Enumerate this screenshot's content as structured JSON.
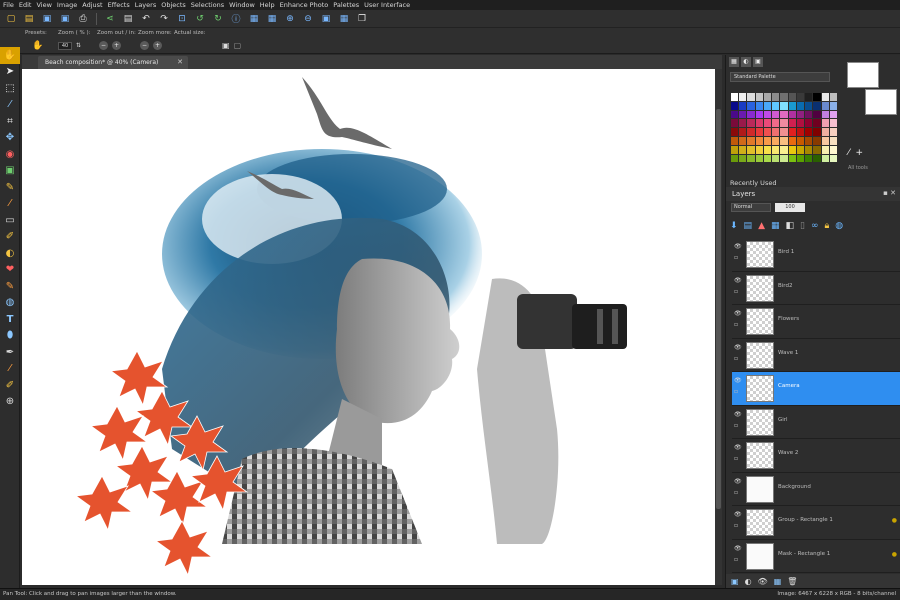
{
  "menu": [
    "File",
    "Edit",
    "View",
    "Image",
    "Adjust",
    "Effects",
    "Layers",
    "Objects",
    "Selections",
    "Window",
    "Help",
    "Enhance Photo",
    "Palettes",
    "User Interface"
  ],
  "toolbar_icons": [
    "new-file-icon",
    "open-icon",
    "save-icon",
    "save-as-icon",
    "print-icon",
    "share-icon",
    "undo-icon",
    "redo-icon",
    "crop-icon",
    "rotate-left-icon",
    "rotate-right-icon",
    "zoom-in-icon",
    "zoom-out-icon",
    "fit-icon",
    "grid-icon",
    "window-icon"
  ],
  "options": {
    "presets_label": "Presets:",
    "zoom_pct_label": "Zoom ( % ):",
    "zoom_pct_value": "40",
    "zoom_inout_label": "Zoom out / in:",
    "zoom_more_label": "Zoom more:",
    "actual_size_label": "Actual size:"
  },
  "tools": [
    "pan-icon",
    "pick-icon",
    "selection-icon",
    "dropper-icon",
    "crop-icon",
    "move-icon",
    "redeye-icon",
    "makeover-icon",
    "clone-icon",
    "scratch-icon",
    "eraser-icon",
    "smudge-icon",
    "dodge-icon",
    "retouch-icon",
    "paint-icon",
    "fill-icon",
    "text-icon",
    "shape-icon",
    "pen-icon",
    "brush-icon",
    "airbrush-icon",
    "add-icon"
  ],
  "document": {
    "tab_title": "Beach composition* @  40% (Camera)",
    "close_symbol": "✕"
  },
  "materials": {
    "palette_name": "Standard Palette",
    "all_tools": "All tools",
    "swatch_colors": [
      "#ffffff",
      "#f0f0f0",
      "#dcdcdc",
      "#c4c4c4",
      "#a8a8a8",
      "#8c8c8c",
      "#707070",
      "#555555",
      "#3a3a3a",
      "#202020",
      "#000000",
      "#e8e8e8",
      "#bdbdbd",
      "#0a0a8a",
      "#1a3cc4",
      "#2a62e0",
      "#3a86f0",
      "#4aa8f8",
      "#60c8ff",
      "#80e0ff",
      "#1a9ad0",
      "#0a6cb0",
      "#0a4e90",
      "#0a3070",
      "#6a8ad0",
      "#8ab0e8",
      "#4a0a8a",
      "#6a1ab0",
      "#8a2ad0",
      "#aa3af0",
      "#c04ae8",
      "#d05ad0",
      "#e06ac0",
      "#b030a0",
      "#902080",
      "#701060",
      "#500040",
      "#c080e0",
      "#e0a0f0",
      "#7a0a3a",
      "#9a1a4a",
      "#ba2a5a",
      "#da3a6a",
      "#ea4a7a",
      "#f06a8a",
      "#f08aa0",
      "#d02050",
      "#b01040",
      "#900030",
      "#700020",
      "#f0a0b0",
      "#f8c0d0",
      "#8a0a0a",
      "#b01a1a",
      "#d02a2a",
      "#e83a3a",
      "#f05050",
      "#f07070",
      "#f09090",
      "#e02020",
      "#c01010",
      "#a00000",
      "#800000",
      "#f0b0a0",
      "#f8d0c0",
      "#c05a0a",
      "#d06a1a",
      "#e07a2a",
      "#f08a3a",
      "#f89a4a",
      "#f8aa60",
      "#f8c080",
      "#e86a10",
      "#c85a00",
      "#a84a00",
      "#883a00",
      "#f8c8a0",
      "#f8e0c0",
      "#c0a00a",
      "#d0b01a",
      "#e0c02a",
      "#f0d03a",
      "#f8e04a",
      "#f8e870",
      "#f8f090",
      "#e8c810",
      "#c8a800",
      "#a88800",
      "#886800",
      "#f8f0b0",
      "#fff8d0",
      "#6a9a0a",
      "#7aaa1a",
      "#8aba2a",
      "#9aca3a",
      "#aada4a",
      "#bae070",
      "#ccea90",
      "#7ac010",
      "#5aa000",
      "#3a8000",
      "#2a6000",
      "#d0f0a0",
      "#e8f8c0"
    ]
  },
  "recently_used": "Recently Used",
  "layers_panel": {
    "title": "Layers",
    "blend_mode": "Normal",
    "opacity": "100",
    "layers": [
      {
        "name": "Bird 1",
        "selected": false,
        "solid": false,
        "star": false
      },
      {
        "name": "Bird2",
        "selected": false,
        "solid": false,
        "star": false
      },
      {
        "name": "Flowers",
        "selected": false,
        "solid": false,
        "star": false
      },
      {
        "name": "Wave 1",
        "selected": false,
        "solid": false,
        "star": false
      },
      {
        "name": "Camera",
        "selected": true,
        "solid": false,
        "star": false
      },
      {
        "name": "Girl",
        "selected": false,
        "solid": false,
        "star": false
      },
      {
        "name": "Wave 2",
        "selected": false,
        "solid": false,
        "star": false
      },
      {
        "name": "Background",
        "selected": false,
        "solid": true,
        "star": false
      },
      {
        "name": "Group - Rectangle 1",
        "selected": false,
        "solid": false,
        "star": true
      },
      {
        "name": "Mask - Rectangle 1",
        "selected": false,
        "solid": true,
        "star": true
      }
    ]
  },
  "status": {
    "left": "Pan Tool: Click and drag to pan images larger than the window.",
    "right": "Image:  6467 x 6228 x RGB - 8 bits/channel"
  }
}
